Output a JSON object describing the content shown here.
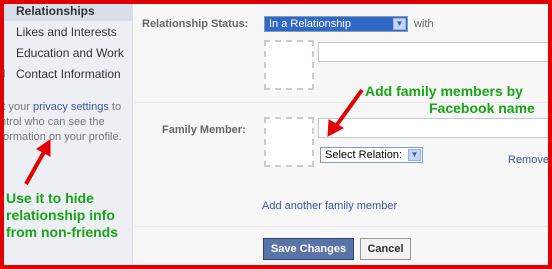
{
  "sidebar": {
    "items": [
      {
        "label": "Relationships",
        "icon": "heart-icon",
        "active": true
      },
      {
        "label": "Likes and Interests",
        "icon": "pencil-icon",
        "active": false
      },
      {
        "label": "Education and Work",
        "icon": "book-icon",
        "active": false
      },
      {
        "label": "Contact Information",
        "icon": "card-icon",
        "active": false
      }
    ],
    "privacy_note": {
      "prefix": "it your",
      "link": "privacy settings",
      "suffix": "to",
      "line2": "ntrol who can see the",
      "line3": "formation on your profile."
    }
  },
  "form": {
    "relationship_status": {
      "label": "Relationship Status:",
      "value": "In a Relationship",
      "with_label": "with"
    },
    "family_member": {
      "label": "Family Member:",
      "relation_select": "Select Relation:",
      "remove_label": "Remove",
      "add_link": "Add another family member"
    }
  },
  "buttons": {
    "save": "Save Changes",
    "cancel": "Cancel"
  },
  "annotations": {
    "family": [
      "Add family members by",
      "Facebook name"
    ],
    "privacy": [
      "Use it to hide",
      "relationship info",
      "from non-friends"
    ],
    "color": "#1aa31a",
    "arrow_color": "#e00000"
  },
  "colors": {
    "link": "#3b5998",
    "frame": "#e00000",
    "primary_button": "#5b74a8"
  }
}
